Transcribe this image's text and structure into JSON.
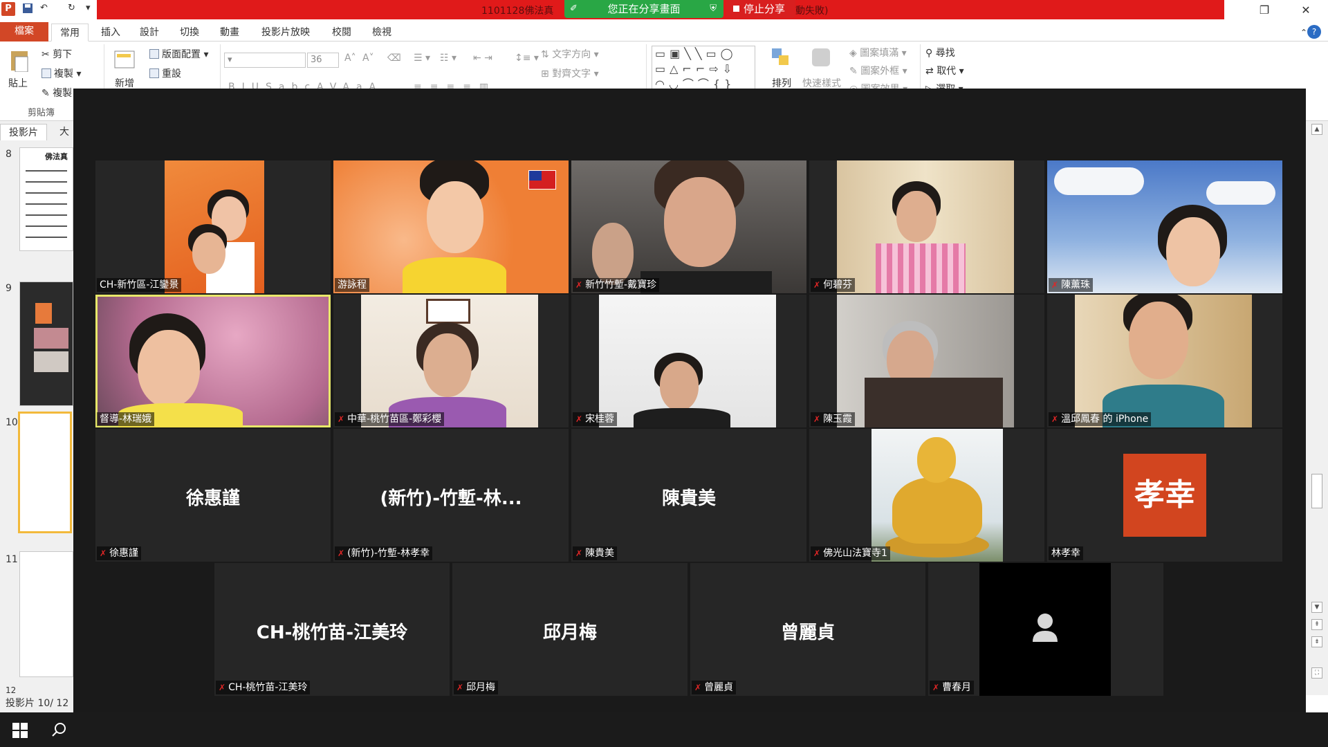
{
  "titlebar": {
    "file_title": "1101128佛法真",
    "title_suffix": "動失敗)",
    "sharing_text": "您正在分享畫面",
    "stop_share": "停止分享"
  },
  "ribbon": {
    "tabs": [
      "檔案",
      "常用",
      "插入",
      "設計",
      "切換",
      "動畫",
      "投影片放映",
      "校閱",
      "檢視"
    ],
    "cut": "剪下",
    "copy": "複製",
    "format_painter": "複製",
    "paste": "貼上",
    "clipboard": "剪貼簿",
    "new_slide": "新增",
    "layout": "版面配置",
    "reset": "重設",
    "font_size": "36",
    "text_direction": "文字方向",
    "align_text": "對齊文字",
    "arrange": "排列",
    "quick_styles": "快速樣式",
    "shape_fill": "圖案填滿",
    "shape_outline": "圖案外框",
    "shape_effects": "圖案效果",
    "find": "尋找",
    "replace": "取代",
    "select": "選取"
  },
  "leftpanel": {
    "tab_slides": "投影片",
    "tab_outline": "大",
    "slide_numbers": [
      "8",
      "9",
      "10",
      "11",
      "12"
    ],
    "slide8_title": "佛法真",
    "status": "投影片 10/ 12"
  },
  "zoom": {
    "rows": [
      [
        {
          "name": "CH-新竹區-江鑾景",
          "muted": false
        },
        {
          "name": "游詠程",
          "muted": false
        },
        {
          "name": "新竹竹塹-戴寶珍",
          "muted": true
        },
        {
          "name": "何碧芬",
          "muted": true
        },
        {
          "name": "陳薰珠",
          "muted": true
        }
      ],
      [
        {
          "name": "督導-林瑞娥",
          "muted": false
        },
        {
          "name": "中華-桃竹苗區-鄭彩櫻",
          "muted": true
        },
        {
          "name": "宋桂蓉",
          "muted": true
        },
        {
          "name": "陳玉霞",
          "muted": true
        },
        {
          "name": "溫邱鳳春 的 iPhone",
          "muted": true
        }
      ],
      [
        {
          "name": "徐惠謹",
          "muted": true,
          "display": "徐惠謹"
        },
        {
          "name": "(新竹)-竹塹-林孝幸",
          "muted": true,
          "display": "(新竹)-竹塹-林..."
        },
        {
          "name": "陳貴美",
          "muted": true,
          "display": "陳貴美"
        },
        {
          "name": "佛光山法寶寺1",
          "muted": true
        },
        {
          "name": "林孝幸",
          "muted": false,
          "badge": "孝幸"
        }
      ],
      [
        {
          "name": "CH-桃竹苗-江美玲",
          "muted": true,
          "display": "CH-桃竹苗-江美玲"
        },
        {
          "name": "邱月梅",
          "muted": true,
          "display": "邱月梅"
        },
        {
          "name": "曾麗貞",
          "muted": true,
          "display": "曾麗貞"
        },
        {
          "name": "曹春月",
          "muted": true
        }
      ]
    ]
  },
  "colors": {
    "zoom_bg": "#1a1a1a",
    "tile_bg": "#262626",
    "share_green": "#29a745",
    "share_red": "#e01a1a",
    "ppt_orange": "#d24726",
    "badge_orange": "#d2451f",
    "active_speaker": "#e8e86a"
  }
}
